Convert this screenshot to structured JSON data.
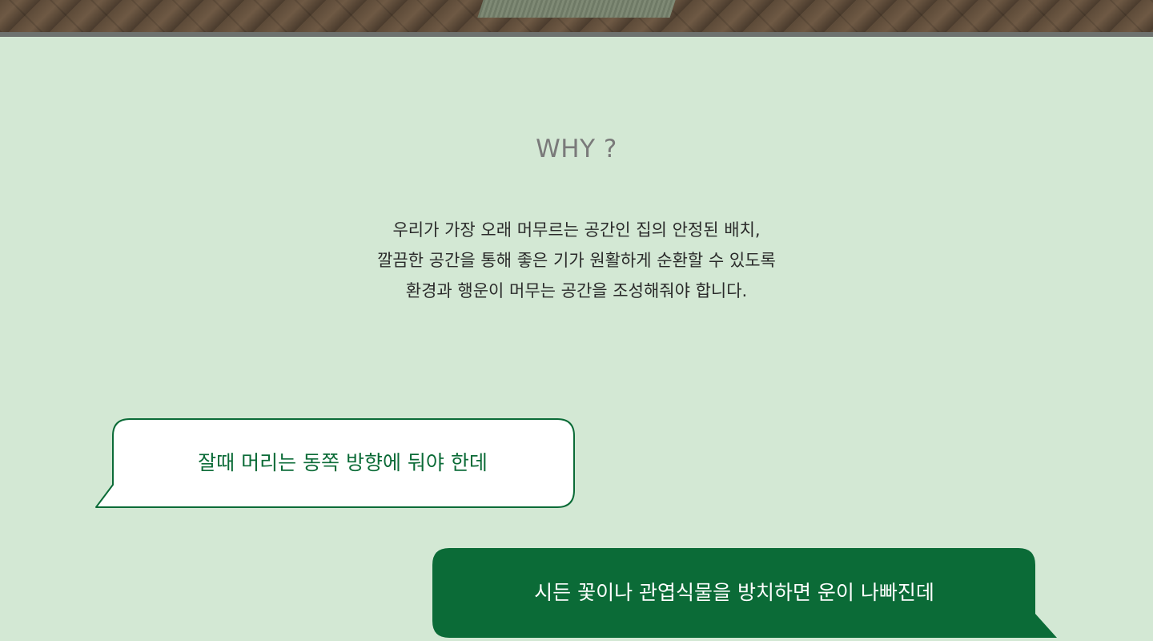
{
  "section": {
    "title": "WHY ?",
    "description_lines": [
      "우리가 가장 오래 머무르는 공간인 집의 안정된 배치,",
      "깔끔한 공간을 통해 좋은 기가 원활하게 순환할 수 있도록",
      "환경과 행운이 머무는 공간을 조성해줘야 합니다."
    ]
  },
  "bubbles": {
    "first": "잘때 머리는 동쪽 방향에 둬야 한데",
    "second": "시든 꽃이나 관엽식물을 방치하면 운이 나빠진데"
  },
  "colors": {
    "background": "#d3e8d4",
    "accent_green": "#0b6b37",
    "title_gray": "#7a7a7a",
    "bubble_white": "#ffffff"
  }
}
